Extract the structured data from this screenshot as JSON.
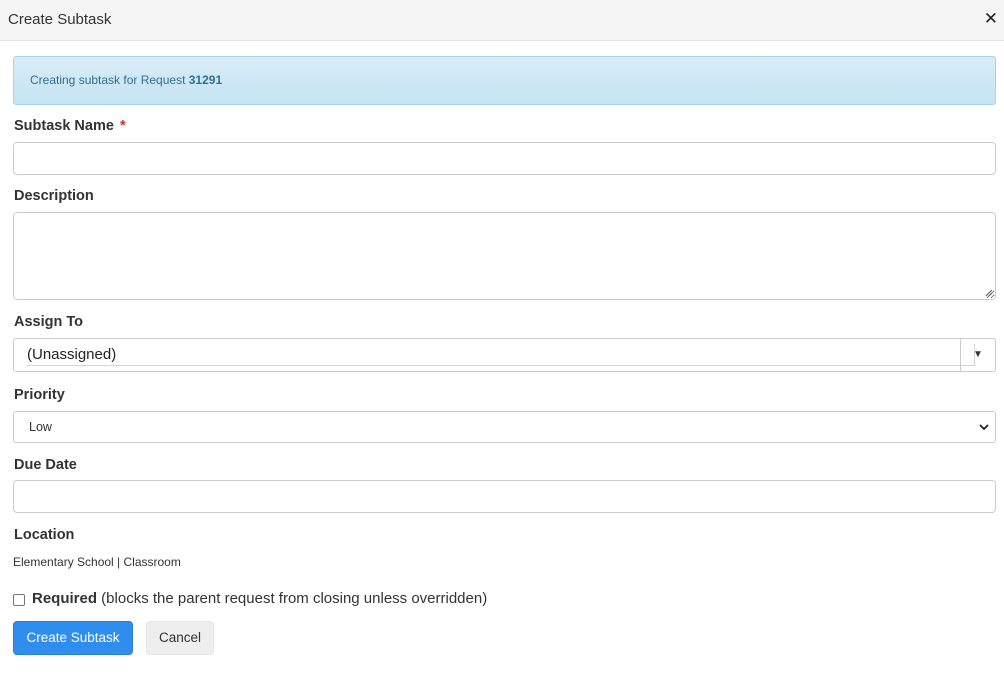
{
  "dialog": {
    "title": "Create Subtask",
    "close_glyph": "✕"
  },
  "alert": {
    "text": "Creating subtask for Request ",
    "request_number": "31291"
  },
  "fields": {
    "subtask_name": {
      "label": "Subtask Name",
      "required_mark": "*",
      "value": ""
    },
    "description": {
      "label": "Description",
      "value": ""
    },
    "assign_to": {
      "label": "Assign To",
      "value": "(Unassigned)",
      "dropdown_icon": "triangle-down-icon"
    },
    "priority": {
      "label": "Priority",
      "selected": "Low",
      "dropdown_icon": "chevron-down-icon"
    },
    "due_date": {
      "label": "Due Date",
      "value": ""
    },
    "location": {
      "label": "Location",
      "value": "Elementary School | Classroom"
    }
  },
  "required_option": {
    "label": "Required",
    "description": " (blocks the parent request from closing unless overridden)",
    "checked": false
  },
  "buttons": {
    "create": "Create Subtask",
    "cancel": "Cancel"
  },
  "colors": {
    "primary": "#2f8ded",
    "alert_bg": "#d9edf7",
    "alert_text": "#31708f",
    "required": "#c9302c"
  }
}
